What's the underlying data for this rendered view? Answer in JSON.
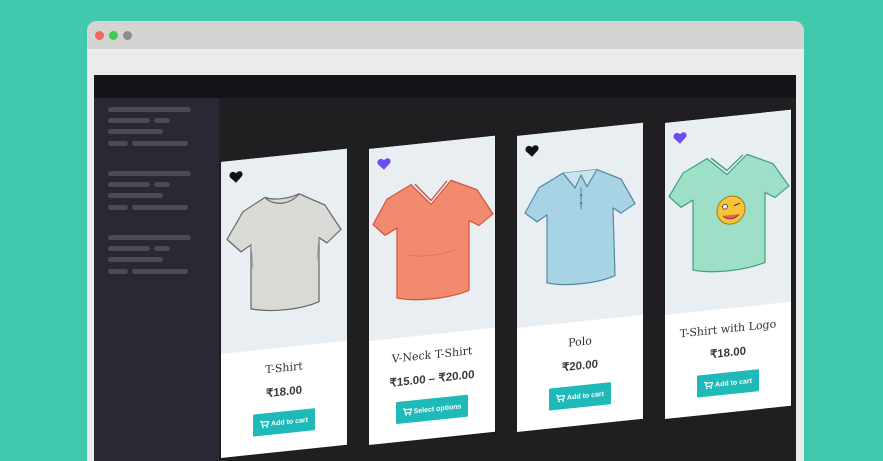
{
  "colors": {
    "background": "#41c9ad",
    "button": "#1fb9b9",
    "heart_active": "#6c4cf0",
    "heart_default": "#111111"
  },
  "products": [
    {
      "title": "T-Shirt",
      "price": "₹18.00",
      "button": "Add to cart",
      "button_icon": "cart-icon",
      "wishlist": "heart-icon",
      "wishlist_active": false,
      "image": "grey-tshirt"
    },
    {
      "title": "V-Neck T-Shirt",
      "price": "₹15.00 – ₹20.00",
      "button": "Select options",
      "button_icon": "cart-icon",
      "wishlist": "heart-icon",
      "wishlist_active": true,
      "image": "coral-vneck-tshirt"
    },
    {
      "title": "Polo",
      "price": "₹20.00",
      "button": "Add to cart",
      "button_icon": "cart-icon",
      "wishlist": "heart-icon",
      "wishlist_active": false,
      "image": "blue-polo"
    },
    {
      "title": "T-Shirt with Logo",
      "price": "₹18.00",
      "button": "Add to cart",
      "button_icon": "cart-icon",
      "wishlist": "heart-icon",
      "wishlist_active": true,
      "image": "mint-tshirt-with-logo"
    }
  ]
}
